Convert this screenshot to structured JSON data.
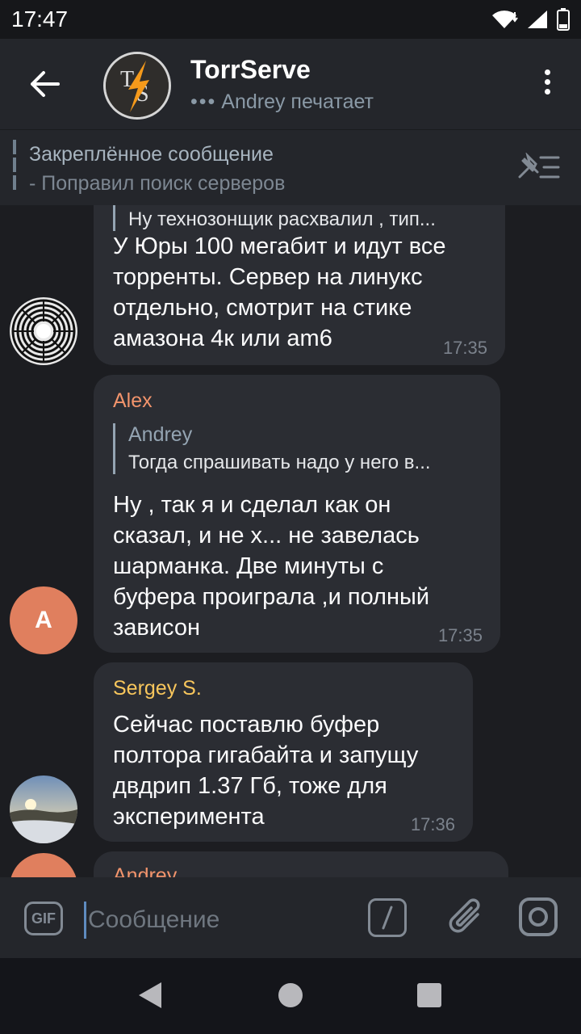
{
  "status_bar": {
    "time": "17:47"
  },
  "header": {
    "title": "TorrServe",
    "typing_dots": "•••",
    "typing_text": "Andrey печатает"
  },
  "pinned": {
    "title": "Закреплённое сообщение",
    "text": "- Поправил поиск серверов"
  },
  "messages": [
    {
      "reply_text": "Ну технозонщик расхвалил , тип...",
      "text": "У Юры 100 мегабит и идут все\nторренты. Сервер на линукс\nотдельно, смотрит на стике\nамазона 4к или am6",
      "time": "17:35"
    },
    {
      "sender": "Alex",
      "sender_color": "#f2946c",
      "avatar_letter": "A",
      "reply_name": "Andrey",
      "reply_text": "Тогда спрашивать надо у него в...",
      "text": "Ну , так я и сделал как он\nсказал, и не х... не завелась\nшарманка. Две минуты с\nбуфера проиграла ,и полный\nзависон",
      "time": "17:35"
    },
    {
      "sender": "Sergey S.",
      "sender_color": "#f8c65c",
      "text": "Сейчас поставлю буфер\nполтора гигабайта и запущу\nдвдрип 1.37 Гб, тоже для\nэксперимента",
      "time": "17:36"
    },
    {
      "sender": "Andrey"
    }
  ],
  "composer": {
    "gif_label": "GIF",
    "placeholder": "Сообщение",
    "command_label": "/"
  },
  "icons": [
    "back-arrow-icon",
    "menu-dots-icon",
    "unpin-icon",
    "gif-icon",
    "bot-command-icon",
    "paperclip-icon",
    "camera-icon",
    "nav-back-icon",
    "nav-home-icon",
    "nav-recents-icon",
    "wifi-icon",
    "signal-icon",
    "battery-icon"
  ]
}
